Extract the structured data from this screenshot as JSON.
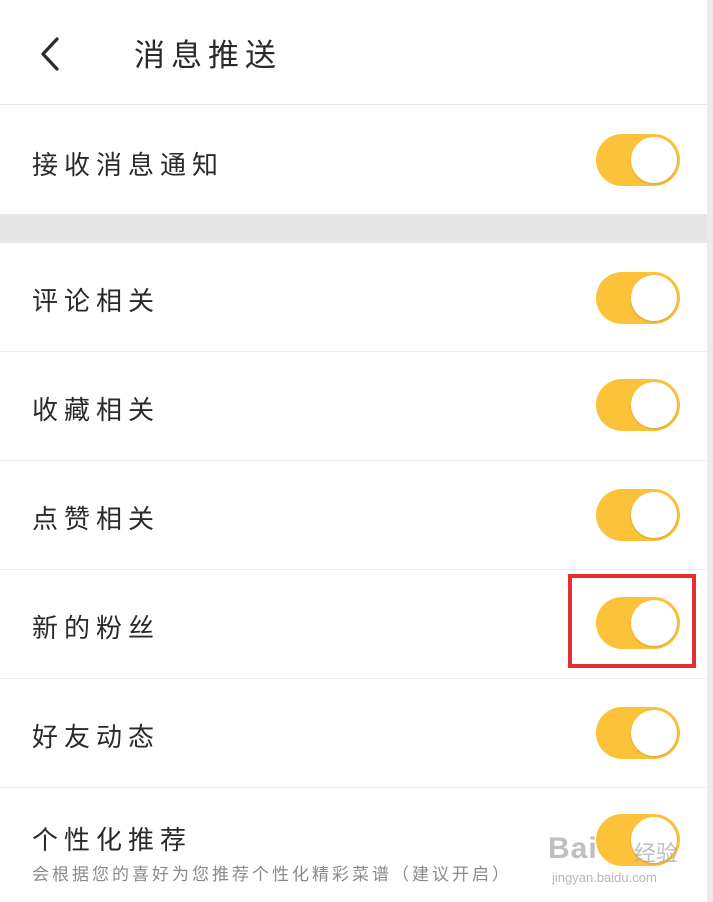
{
  "header": {
    "back_icon": "chevron-left-icon",
    "title": "消息推送"
  },
  "settings": [
    {
      "label": "接收消息通知",
      "enabled": true
    },
    {
      "label": "评论相关",
      "enabled": true
    },
    {
      "label": "收藏相关",
      "enabled": true
    },
    {
      "label": "点赞相关",
      "enabled": true
    },
    {
      "label": "新的粉丝",
      "enabled": true
    },
    {
      "label": "好友动态",
      "enabled": true
    },
    {
      "label": "个性化推荐",
      "sublabel": "会根据您的喜好为您推荐个性化精彩菜谱（建议开启）",
      "enabled": true
    }
  ],
  "colors": {
    "toggle_on": "#fcc33a",
    "highlight": "#e52e2e",
    "section_gap": "#e7e7e7"
  },
  "watermark": {
    "logo": "Bai",
    "text": "经验",
    "url": "jingyan.baidu.com"
  }
}
